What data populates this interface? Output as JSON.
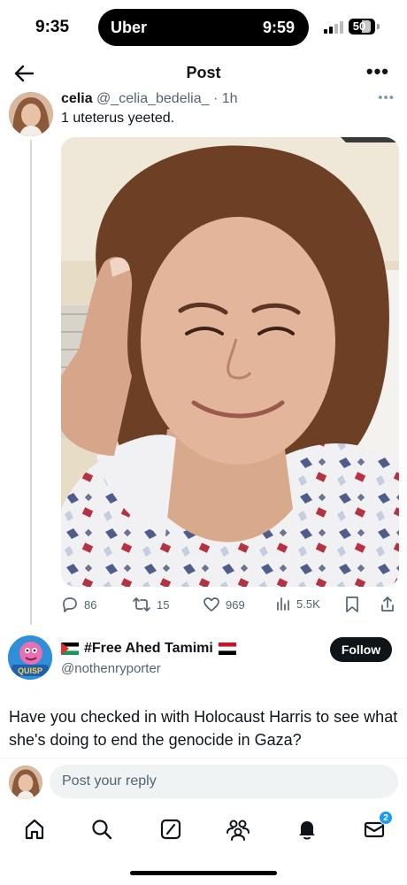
{
  "status_bar": {
    "time": "9:35",
    "island_app": "Uber",
    "island_time": "9:59",
    "battery": "50"
  },
  "header": {
    "title": "Post"
  },
  "tweet": {
    "author_name": "celia",
    "handle": "@_celia_bedelia_",
    "separator": "·",
    "age": "1h",
    "text": "1 uteterus yeeted.",
    "stats": {
      "replies": "86",
      "reposts": "15",
      "likes": "969",
      "views": "5.5K"
    }
  },
  "reply": {
    "name": "#Free Ahed Tamimi",
    "handle": "@nothenryporter",
    "follow_label": "Follow",
    "avatar_text": "QUISP",
    "text": "Have you checked in with Holocaust Harris to see what she's doing to end the genocide in Gaza?"
  },
  "compose": {
    "placeholder": "Post your reply"
  },
  "nav": {
    "messages_badge": "2"
  },
  "colors": {
    "accent": "#1d9bf0",
    "text": "#0f1419",
    "muted": "#536471",
    "border": "#eff3f4"
  }
}
